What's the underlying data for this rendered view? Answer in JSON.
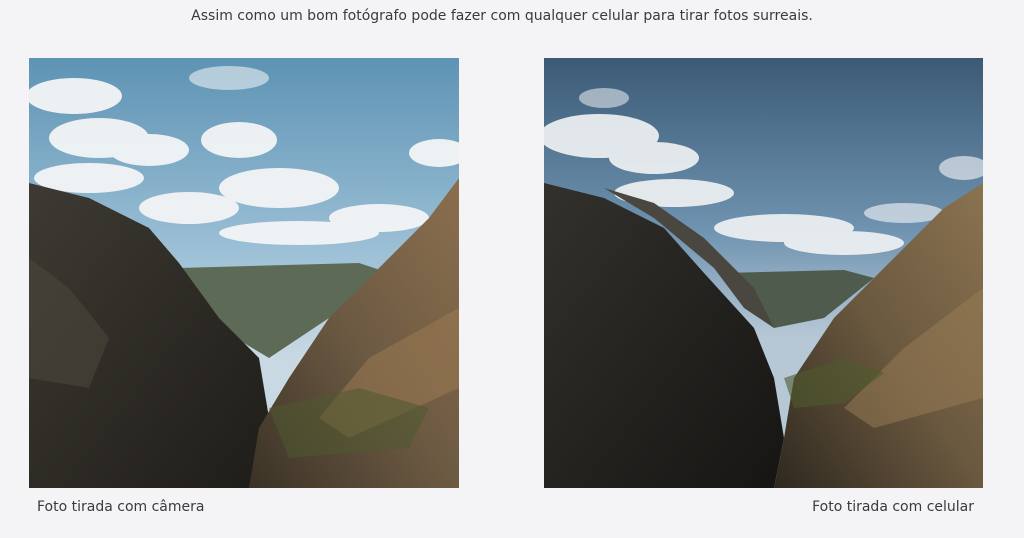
{
  "headline": "Assim como um bom fotógrafo pode fazer com qualquer celular para tirar fotos surreais.",
  "photos": [
    {
      "icon": "canyon-landscape-photo",
      "caption": "Foto tirada com câmera",
      "sky_color": "#6f9fbd"
    },
    {
      "icon": "canyon-landscape-photo",
      "caption": "Foto tirada com celular",
      "sky_color": "#4f7595"
    }
  ]
}
